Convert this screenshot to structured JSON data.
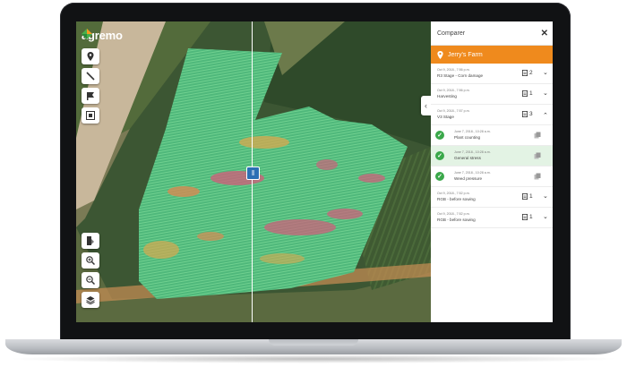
{
  "app": {
    "logo_text": "agremo"
  },
  "toolbar_top": [
    {
      "name": "pin-tool-button",
      "icon": "pin-icon"
    },
    {
      "name": "line-tool-button",
      "icon": "ruler-icon"
    },
    {
      "name": "flag-tool-button",
      "icon": "flag-icon"
    },
    {
      "name": "grid-tool-button",
      "icon": "grid-icon"
    }
  ],
  "toolbar_bottom": [
    {
      "name": "compare-tool-button",
      "icon": "compare-icon"
    },
    {
      "name": "zoom-in-button",
      "icon": "zoom-in-icon"
    },
    {
      "name": "zoom-out-button",
      "icon": "zoom-out-icon"
    },
    {
      "name": "layers-button",
      "icon": "layers-icon"
    }
  ],
  "panel": {
    "title": "Comparer",
    "close_icon": "close-icon",
    "farm": {
      "name": "Jerry's Farm",
      "icon": "location-pin-icon"
    },
    "reports": [
      {
        "date": "Oct 9, 2018., 7:56 p.m.",
        "name": "R3 Stage - Corn damage",
        "count": "2",
        "expanded": false
      },
      {
        "date": "Oct 9, 2018., 7:56 p.m.",
        "name": "Harvesting",
        "count": "1",
        "expanded": false
      },
      {
        "date": "Oct 9, 2018., 7:57 p.m.",
        "name": "V3 Stage",
        "count": "3",
        "expanded": true,
        "analyses": [
          {
            "date": "June 7, 2018., 10:28 a.m.",
            "name": "Plant counting",
            "active": false
          },
          {
            "date": "June 7, 2018., 10:28 a.m.",
            "name": "General stress",
            "active": true
          },
          {
            "date": "June 7, 2018., 10:28 a.m.",
            "name": "Weed pressure",
            "active": false
          }
        ]
      },
      {
        "date": "Oct 9, 2018., 7:52 p.m.",
        "name": "RGB - before sowing",
        "count": "1",
        "expanded": false
      },
      {
        "date": "Oct 9, 2018., 7:52 p.m.",
        "name": "RGB - before sowing",
        "count": "1",
        "expanded": false
      }
    ]
  },
  "colors": {
    "accent": "#ef8a1d",
    "check": "#3aa84a",
    "handle": "#2b6fb4",
    "active_row": "#e3f3e4"
  }
}
